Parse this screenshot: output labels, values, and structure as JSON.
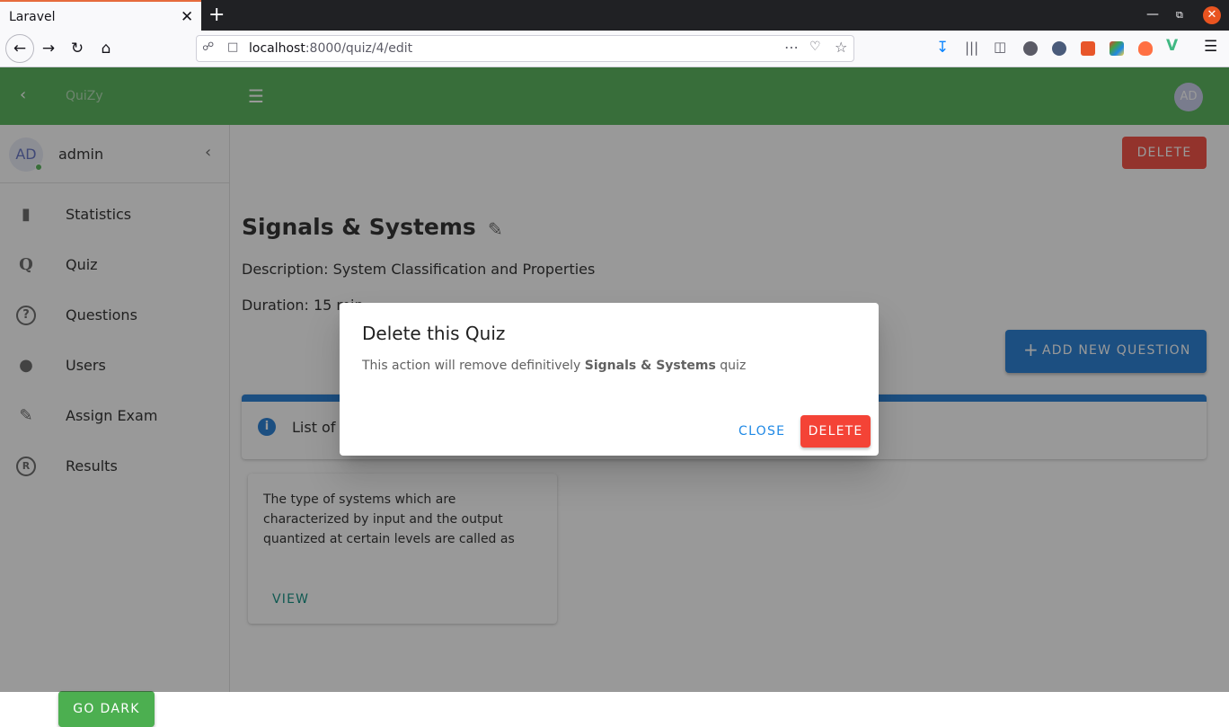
{
  "browser": {
    "tab_title": "Laravel",
    "url_host": "localhost",
    "url_path": ":8000/quiz/4/edit"
  },
  "appbar": {
    "brand": "QuiZy",
    "avatar": "AD"
  },
  "sidebar": {
    "user_avatar": "AD",
    "user_name": "admin",
    "items": [
      {
        "label": "Statistics",
        "icon": "bar-chart-icon"
      },
      {
        "label": "Quiz",
        "icon": "q-icon"
      },
      {
        "label": "Questions",
        "icon": "help-circle-icon"
      },
      {
        "label": "Users",
        "icon": "person-icon"
      },
      {
        "label": "Assign Exam",
        "icon": "person-edit-icon"
      },
      {
        "label": "Results",
        "icon": "registered-icon"
      }
    ],
    "go_dark": "GO DARK"
  },
  "main": {
    "delete_label": "DELETE",
    "quiz_title": "Signals & Systems",
    "description": "Description: System Classification and Properties",
    "duration": "Duration: 15 min",
    "add_question_label": "ADD NEW QUESTION",
    "alert_text": "List of",
    "question_card": {
      "text": "The type of systems which are characterized by input and the output quantized at certain levels are called as",
      "view_label": "VIEW"
    }
  },
  "dialog": {
    "title": "Delete this Quiz",
    "body_prefix": "This action will remove definitively ",
    "body_bold": "Signals & Systems",
    "body_suffix": " quiz",
    "close_label": "CLOSE",
    "delete_label": "DELETE"
  },
  "colors": {
    "appbar": "#4caf50",
    "delete_red": "#f44336",
    "primary_blue": "#1976d2",
    "teal": "#00897b"
  }
}
